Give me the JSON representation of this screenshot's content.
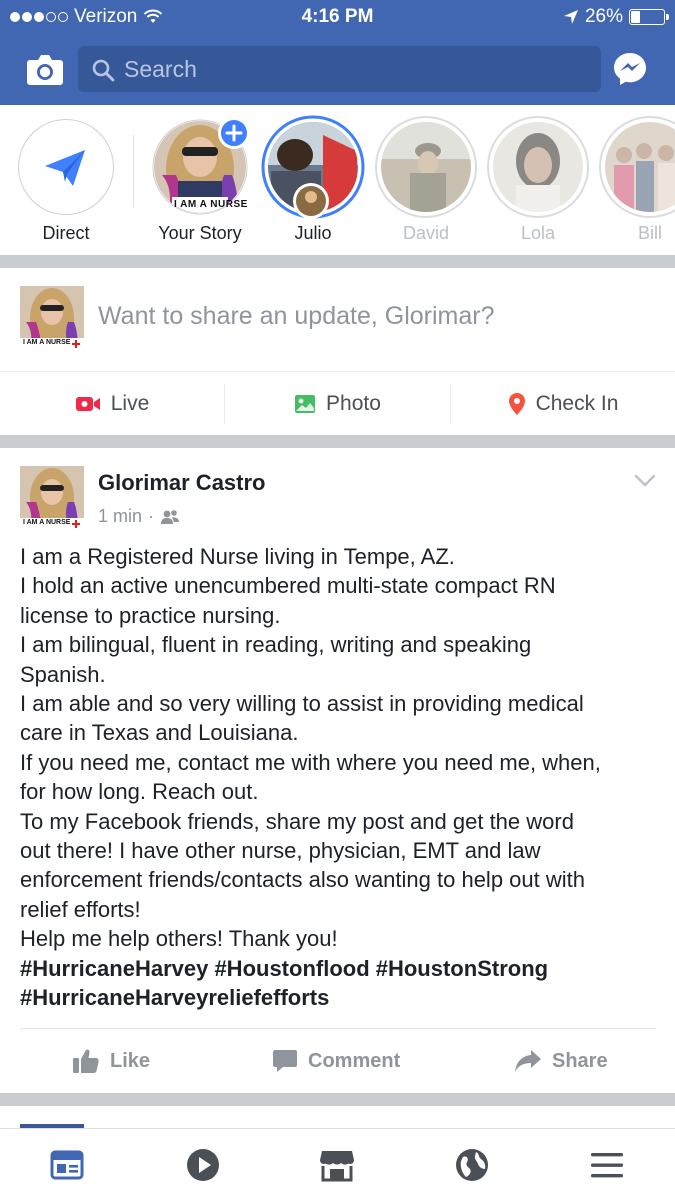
{
  "status_bar": {
    "carrier": "Verizon",
    "time": "4:16 PM",
    "battery": "26%"
  },
  "header": {
    "search_placeholder": "Search"
  },
  "stories": [
    {
      "label": "Direct",
      "active": true
    },
    {
      "label": "Your Story",
      "active": true
    },
    {
      "label": "Julio",
      "active": true
    },
    {
      "label": "David",
      "active": false
    },
    {
      "label": "Lola",
      "active": false
    },
    {
      "label": "Bill",
      "active": false
    }
  ],
  "story_overlay_text": "I AM A NURSE",
  "composer": {
    "placeholder": "Want to share an update, Glorimar?",
    "avatar_caption": "I AM A NURSE"
  },
  "composer_actions": [
    {
      "label": "Live",
      "icon": "live-video-icon"
    },
    {
      "label": "Photo",
      "icon": "photo-icon"
    },
    {
      "label": "Check In",
      "icon": "location-pin-icon"
    }
  ],
  "post": {
    "author": "Glorimar Castro",
    "time": "1 min",
    "audience_icon": "friends-icon",
    "lines": [
      "I am a Registered Nurse living in Tempe, AZ.",
      "I hold an active unencumbered multi-state compact RN",
      "license to practice nursing.",
      "I am bilingual, fluent in reading, writing and speaking",
      "Spanish.",
      "I am able and so very willing to assist in providing medical",
      "care in Texas and Louisiana.",
      "If you need me, contact me with where you need me, when,",
      "for how long. Reach out.",
      "To my Facebook friends, share my post and get the word",
      "out there! I have other nurse, physician, EMT and law",
      "enforcement friends/contacts also wanting to help out with",
      "relief efforts!",
      "Help me help others! Thank you!"
    ],
    "hashtags": [
      "#HurricaneHarvey #Houstonflood #HoustonStrong",
      "#HurricaneHarveyreliefefforts"
    ],
    "actions": {
      "like": "Like",
      "comment": "Comment",
      "share": "Share"
    }
  },
  "tabs": [
    "news-feed-icon",
    "watch-icon",
    "marketplace-icon",
    "notifications-globe-icon",
    "menu-icon"
  ],
  "colors": {
    "brand": "#4267b2",
    "active_tab": "#4267b2",
    "live_red": "#f02849",
    "photo_green": "#45bd62",
    "checkin_pink": "#f5533d"
  }
}
